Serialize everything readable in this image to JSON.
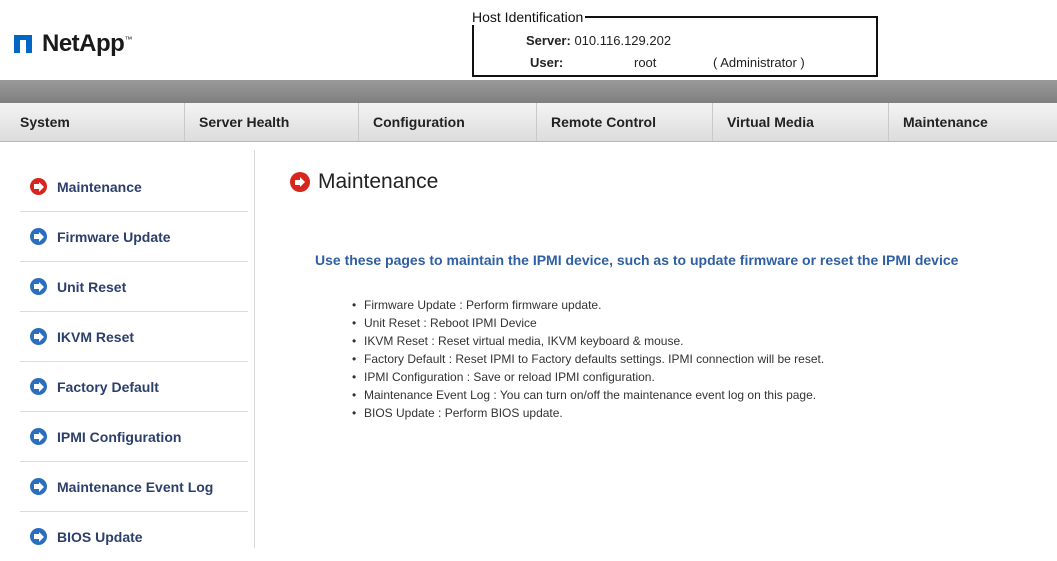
{
  "brand": {
    "name": "NetApp",
    "mark": "™"
  },
  "host": {
    "legend": "Host Identification",
    "server_label": "Server:",
    "server_value": "010.116.129.202",
    "user_label": "User:",
    "user_value": "root",
    "user_role": "( Administrator )"
  },
  "nav": [
    {
      "label": "System"
    },
    {
      "label": "Server Health"
    },
    {
      "label": "Configuration"
    },
    {
      "label": "Remote Control"
    },
    {
      "label": "Virtual Media"
    },
    {
      "label": "Maintenance"
    }
  ],
  "sidebar": [
    {
      "label": "Maintenance",
      "icon": "arrow-right-circle-red-icon"
    },
    {
      "label": "Firmware Update",
      "icon": "arrow-right-circle-blue-icon"
    },
    {
      "label": "Unit Reset",
      "icon": "arrow-right-circle-blue-icon"
    },
    {
      "label": "IKVM Reset",
      "icon": "arrow-right-circle-blue-icon"
    },
    {
      "label": "Factory Default",
      "icon": "arrow-right-circle-blue-icon"
    },
    {
      "label": "IPMI Configuration",
      "icon": "arrow-right-circle-blue-icon"
    },
    {
      "label": "Maintenance Event Log",
      "icon": "arrow-right-circle-blue-icon"
    },
    {
      "label": "BIOS Update",
      "icon": "arrow-right-circle-blue-icon"
    }
  ],
  "main": {
    "title": "Maintenance",
    "description": "Use these pages to maintain the IPMI device, such as to update firmware or reset the IPMI device",
    "items": [
      "Firmware Update : Perform firmware update.",
      "Unit Reset : Reboot IPMI Device",
      "IKVM Reset : Reset virtual media, IKVM keyboard & mouse.",
      "Factory Default : Reset IPMI to Factory defaults settings. IPMI connection will be reset.",
      "IPMI Configuration : Save or reload IPMI configuration.",
      "Maintenance Event Log : You can turn on/off the maintenance event log on this page.",
      "BIOS Update : Perform BIOS update."
    ]
  },
  "colors": {
    "accent": "#2f5fa3",
    "active_icon": "#d8261c",
    "icon": "#2a6fbf",
    "brand": "#0067c5"
  }
}
